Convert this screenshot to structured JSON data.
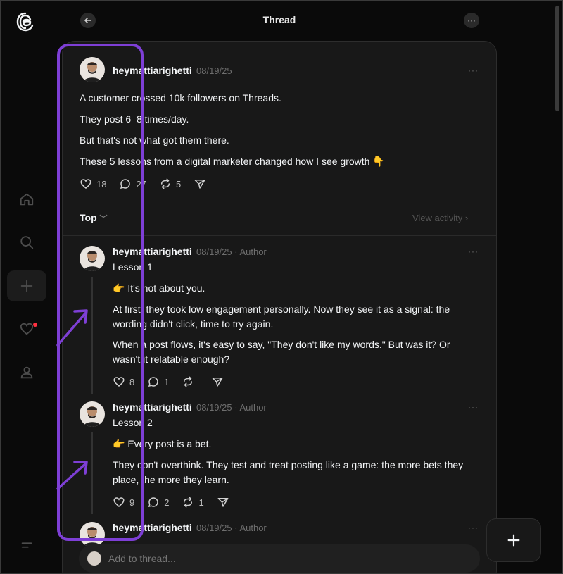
{
  "header": {
    "title": "Thread",
    "back_icon": "arrow-left-icon",
    "more_icon": "ellipsis-icon"
  },
  "nav": {
    "items": [
      {
        "name": "home",
        "icon": "home-icon"
      },
      {
        "name": "search",
        "icon": "search-icon"
      },
      {
        "name": "create",
        "icon": "plus-icon"
      },
      {
        "name": "activity",
        "icon": "heart-icon"
      },
      {
        "name": "profile",
        "icon": "person-icon"
      }
    ],
    "menu_icon": "menu-icon",
    "notification_color": "#ff3040"
  },
  "post": {
    "username": "heymattiarighetti",
    "date": "08/19/25",
    "lines": [
      "A customer crossed 10k followers on Threads.",
      "They post 6–8 times/day.",
      "But that's not what got them there.",
      "These 5 lessons from a digital marketer changed how I see growth 👇"
    ],
    "likes": "18",
    "replies": "27",
    "reposts": "5"
  },
  "sort": {
    "label": "Top",
    "view_activity": "View activity"
  },
  "replies": [
    {
      "username": "heymattiarighetti",
      "date": "08/19/25",
      "author_label": "Author",
      "title": "Lesson 1",
      "lines": [
        "👉 It's not about you.",
        "At first, they took low engagement personally. Now they see it as a signal: the",
        "wording didn't click, time to try again.",
        "When a post flows, it's easy to say, \"They don't like my words.\" But was it? Or",
        "wasn't it relatable enough?"
      ],
      "likes": "8",
      "replies": "1",
      "reposts": ""
    },
    {
      "username": "heymattiarighetti",
      "date": "08/19/25",
      "author_label": "Author",
      "title": "Lesson 2",
      "lines": [
        "👉 Every post is a bet.",
        "They don't overthink. They test and treat posting like a game: the more bets they",
        "place, the more they learn."
      ],
      "likes": "9",
      "replies": "2",
      "reposts": "1"
    },
    {
      "username": "heymattiarighetti",
      "date": "08/19/25",
      "author_label": "Author"
    }
  ],
  "composer": {
    "placeholder": "Add to thread..."
  },
  "annotation": {
    "color": "#7e3fd6"
  }
}
